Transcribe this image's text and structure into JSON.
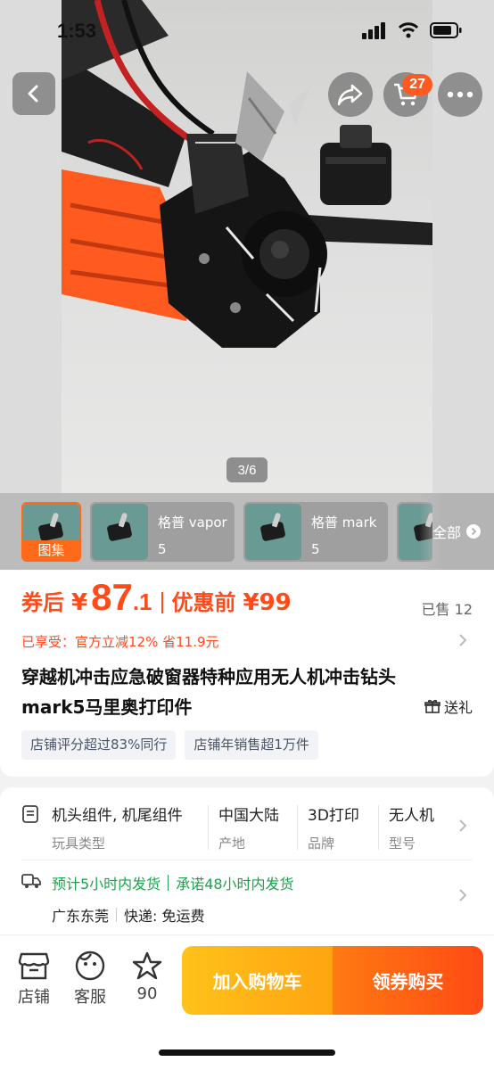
{
  "status_bar": {
    "time": "1:53"
  },
  "header": {
    "cart_count": "27"
  },
  "gallery": {
    "counter": "3/6"
  },
  "thumbnails": {
    "items": [
      {
        "label": "图集"
      },
      {
        "label": "格普 vapor 5"
      },
      {
        "label": "格普 mark5"
      }
    ],
    "all_label": "全部"
  },
  "price": {
    "prefix": "券后",
    "currency": "¥",
    "integer": "87",
    "decimal": ".1",
    "original_label": "优惠前",
    "original": "¥99",
    "sold": "已售 12",
    "promo": "已享受：官方立减12% 省11.9元"
  },
  "product": {
    "title": "穿越机冲击应急破窗器特种应用无人机冲击钻头mark5马里奥打印件",
    "gift": "送礼",
    "tags": [
      "店铺评分超过83%同行",
      "店铺年销售超1万件"
    ]
  },
  "specs": [
    {
      "value": "机头组件, 机尾组件",
      "key": "玩具类型"
    },
    {
      "value": "中国大陆",
      "key": "产地"
    },
    {
      "value": "3D打印",
      "key": "品牌"
    },
    {
      "value": "无人机",
      "key": "型号"
    }
  ],
  "shipping": {
    "estimate": "预计5小时内发货",
    "promise": "承诺48小时内发货",
    "location": "广东东莞",
    "express": "快递: 免运费"
  },
  "bottom_bar": {
    "store": "店铺",
    "service": "客服",
    "favorites": "90",
    "add_cart": "加入购物车",
    "buy": "领券购买"
  },
  "colors": {
    "accent": "#ff4a1a",
    "badge": "#ff5a1f",
    "ship_green": "#1aa34a",
    "cart_button": "#ffb212",
    "buy_button": "#ff5a14"
  }
}
